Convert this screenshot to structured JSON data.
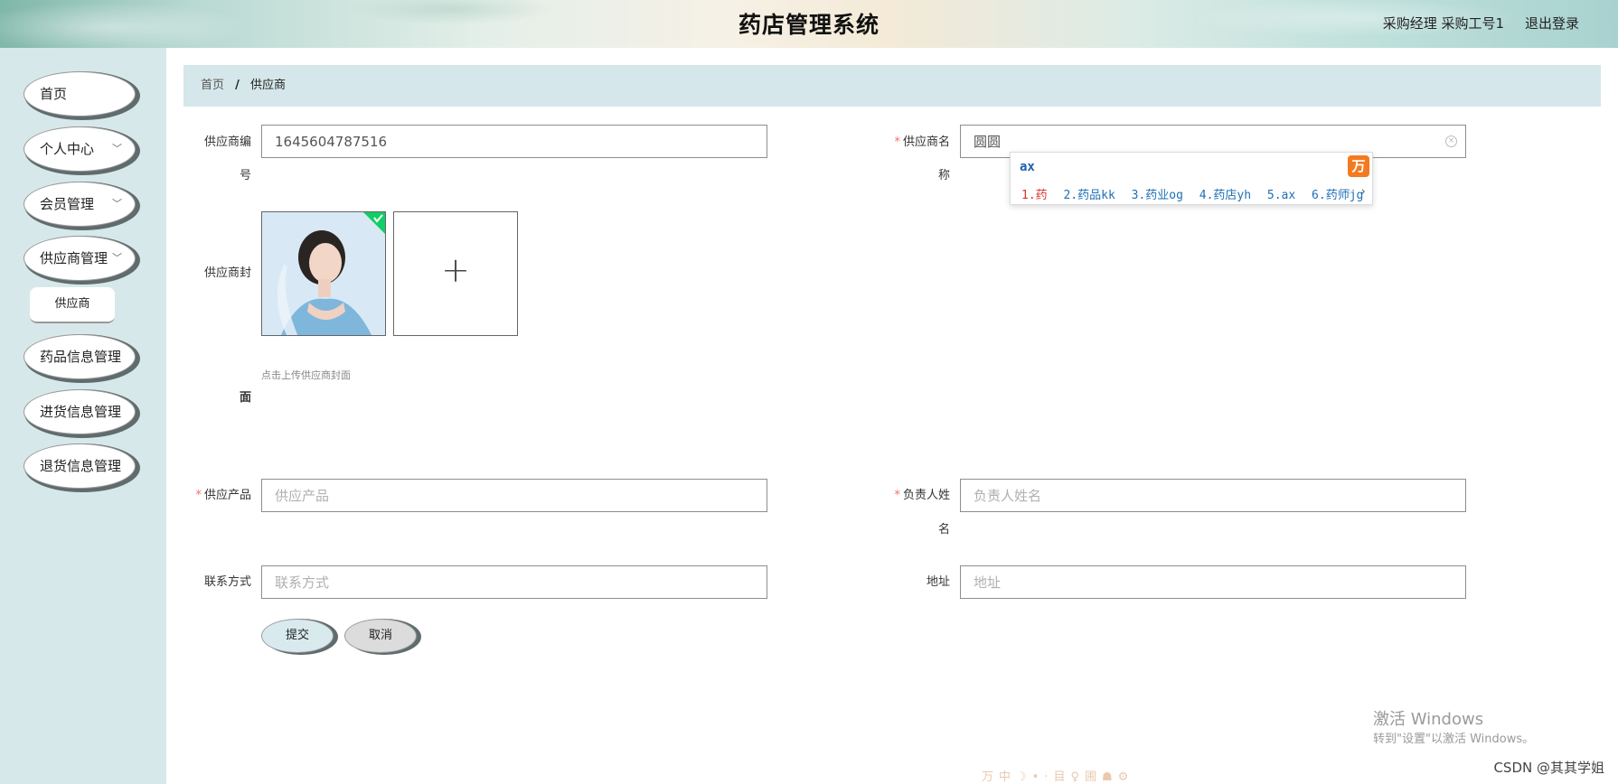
{
  "header": {
    "title": "药店管理系统",
    "user": "采购经理 采购工号1",
    "logout": "退出登录"
  },
  "sidebar": {
    "items": [
      {
        "label": "首页",
        "has_arrow": false
      },
      {
        "label": "个人中心",
        "has_arrow": true
      },
      {
        "label": "会员管理",
        "has_arrow": true
      },
      {
        "label": "供应商管理",
        "has_arrow": true
      },
      {
        "label": "药品信息管理",
        "has_arrow": false
      },
      {
        "label": "进货信息管理",
        "has_arrow": false
      },
      {
        "label": "退货信息管理",
        "has_arrow": false
      }
    ],
    "sub_item": "供应商",
    "arrow_glyph": "﹀"
  },
  "breadcrumb": {
    "home": "首页",
    "separator": "/",
    "current": "供应商"
  },
  "form": {
    "supplier_no": {
      "label_line1": "供应商编",
      "label_line2": "号",
      "value": "1645604787516"
    },
    "supplier_name": {
      "label_line1": "供应商名",
      "label_line2": "称",
      "value": "圆圆",
      "required": "*"
    },
    "cover": {
      "label_line1": "供应商封",
      "label_line2": "面",
      "upload_tip": "点击上传供应商封面",
      "plus": "+"
    },
    "product": {
      "label": "供应产品",
      "placeholder": "供应产品",
      "required": "*"
    },
    "owner": {
      "label_line1": "负责人姓",
      "label_line2": "名",
      "placeholder": "负责人姓名",
      "required": "*"
    },
    "contact": {
      "label": "联系方式",
      "placeholder": "联系方式"
    },
    "address": {
      "label": "地址",
      "placeholder": "地址"
    },
    "submit": "提交",
    "cancel": "取消"
  },
  "ime": {
    "input": "ax",
    "logo": "万",
    "candidates": [
      "1.药",
      "2.药品kk",
      "3.药业og",
      "4.药店yh",
      "5.ax",
      "6.药师jg"
    ],
    "prev": "‹",
    "next": "›"
  },
  "watermark": {
    "title": "激活 Windows",
    "subtitle": "转到\"设置\"以激活 Windows。"
  },
  "csdn": "CSDN @其其学姐",
  "tray_icons": "万中☽•·目♀圃☗⚙",
  "colors": {
    "required": "#f56c6c",
    "sidebar_bg": "#d7e8ea",
    "breadcrumb_bg": "#d5e7ea",
    "ime_blue": "#1d6fb5",
    "ime_orange": "#f47a20",
    "upload_success": "#13ce66"
  }
}
